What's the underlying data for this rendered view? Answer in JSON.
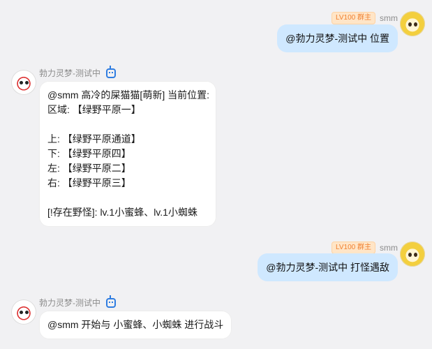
{
  "messages": [
    {
      "side": "right",
      "sender": "smm",
      "badge": "LV100 群主",
      "text": "@勃力灵梦-测试中 位置"
    },
    {
      "side": "left",
      "sender": "勃力灵梦-测试中",
      "lines": [
        "@smm 高冷的屎猫猫[萌新] 当前位置:",
        "区域: 【绿野平原一】",
        "",
        "上: 【绿野平原通道】",
        "下: 【绿野平原四】",
        "左: 【绿野平原二】",
        "右: 【绿野平原三】",
        "",
        "[!存在野怪]: lv.1小蜜蜂、lv.1小蜘蛛"
      ]
    },
    {
      "side": "right",
      "sender": "smm",
      "badge": "LV100 群主",
      "text": "@勃力灵梦-测试中 打怪遇敌"
    },
    {
      "side": "left",
      "sender": "勃力灵梦-测试中",
      "lines": [
        "@smm 开始与 小蜜蜂、小蜘蛛 进行战斗"
      ]
    }
  ]
}
